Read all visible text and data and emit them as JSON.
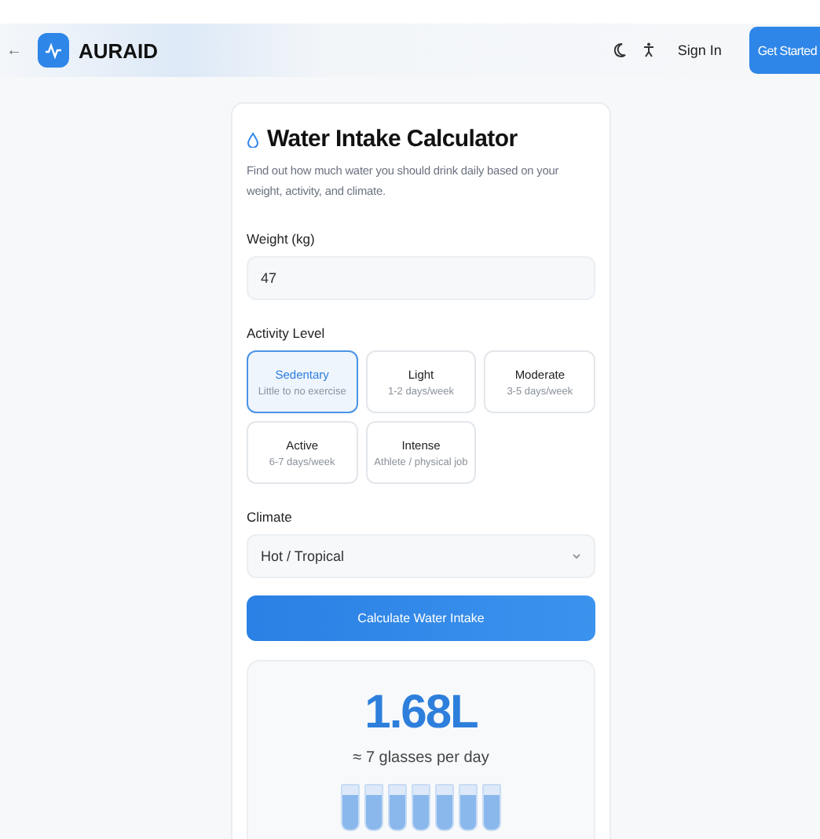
{
  "header": {
    "back": "←",
    "brand": "AURAID",
    "sign_in": "Sign In",
    "get_started": "Get Started"
  },
  "card": {
    "title": "Water Intake Calculator",
    "description": "Find out how much water you should drink daily based on your weight, activity, and climate.",
    "weight": {
      "label": "Weight (kg)",
      "value": "47"
    },
    "activity": {
      "label": "Activity Level",
      "options": [
        {
          "name": "Sedentary",
          "detail": "Little to no exercise",
          "selected": true
        },
        {
          "name": "Light",
          "detail": "1-2 days/week",
          "selected": false
        },
        {
          "name": "Moderate",
          "detail": "3-5 days/week",
          "selected": false
        },
        {
          "name": "Active",
          "detail": "6-7 days/week",
          "selected": false
        },
        {
          "name": "Intense",
          "detail": "Athlete / physical job",
          "selected": false
        }
      ]
    },
    "climate": {
      "label": "Climate",
      "value": "Hot / Tropical"
    },
    "button": "Calculate Water Intake",
    "result": {
      "amount": "1.68L",
      "glasses_text": "≈ 7 glasses per day",
      "glasses": [
        {
          "filled": true
        },
        {
          "filled": true
        },
        {
          "filled": true
        },
        {
          "filled": true
        },
        {
          "filled": true
        },
        {
          "filled": true
        },
        {
          "filled": true
        }
      ]
    }
  }
}
